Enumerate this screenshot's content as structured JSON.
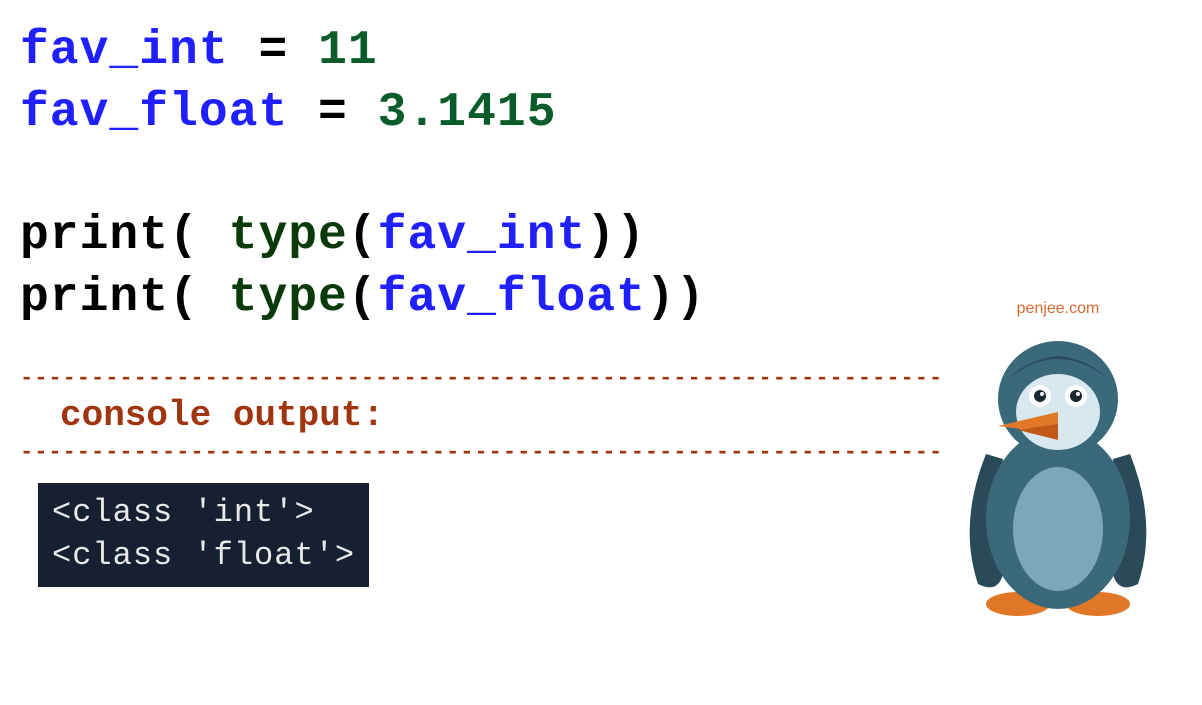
{
  "code": {
    "line1": {
      "var": "fav_int",
      "op": " = ",
      "num": "11"
    },
    "line2": {
      "var": "fav_float",
      "op": " = ",
      "num": "3.1415"
    },
    "line3": {
      "fn": "print",
      "p1": "( ",
      "kw": "type",
      "p2": "(",
      "arg": "fav_int",
      "p3": "))"
    },
    "line4": {
      "fn": "print",
      "p1": "( ",
      "kw": "type",
      "p2": "(",
      "arg": "fav_float",
      "p3": "))"
    }
  },
  "separator": "-------------------------------------------------------------------------------------------------------------------------------------",
  "console_label": "console output:",
  "console_output": {
    "line1": "<class 'int'>",
    "line2": "<class 'float'>"
  },
  "branding": "penjee.com"
}
